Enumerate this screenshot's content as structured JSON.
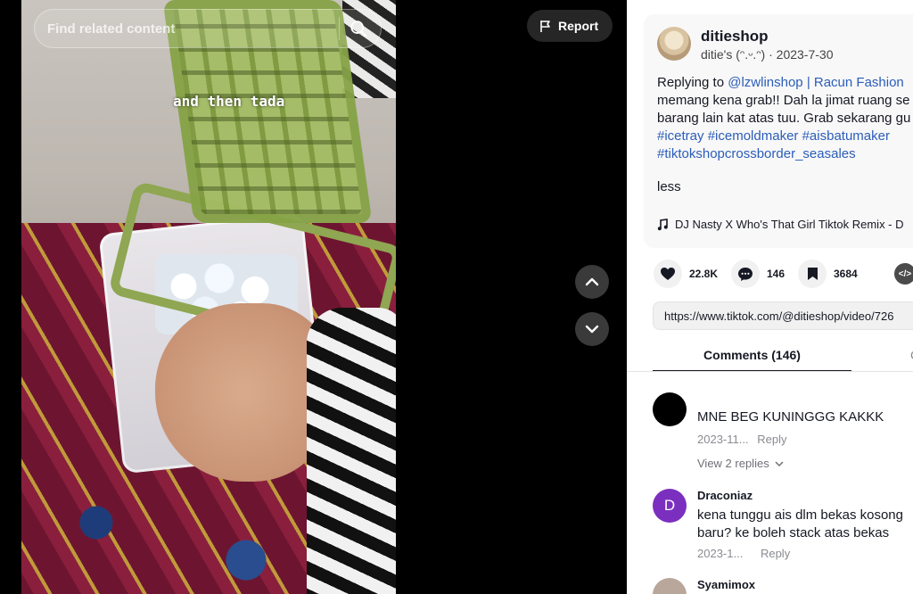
{
  "search": {
    "placeholder": "Find related content"
  },
  "video": {
    "caption": "and then tada"
  },
  "report": {
    "label": "Report"
  },
  "author": {
    "name": "ditieshop",
    "display_name": "ditie's (ᵔ.ᵕ.ᵔ)",
    "date": "2023-7-30"
  },
  "description": {
    "reply_prefix": "Replying to ",
    "mention": "@lzwlinshop | Racun Fashion",
    "line2": "memang kena grab!! Dah la jimat ruang se",
    "line3": "barang lain kat atas tuu. Grab sekarang gu",
    "tags_line1": [
      "#icetray",
      "#icemoldmaker",
      "#aisbatumaker"
    ],
    "tags_line2": "#tiktokshopcrossborder_seasales",
    "less_label": "less"
  },
  "music": {
    "title": "DJ Nasty X Who's That Girl Tiktok Remix - D"
  },
  "actions": {
    "likes": "22.8K",
    "comments": "146",
    "saves": "3684",
    "embed_label": "</>"
  },
  "link": {
    "url": "https://www.tiktok.com/@ditieshop/video/726"
  },
  "tabs": {
    "comments_label": "Comments (146)"
  },
  "comments": [
    {
      "name": "",
      "text": "MNE BEG KUNINGGG KAKKK",
      "date": "2023-11...",
      "reply_label": "Reply",
      "replies_label": "View 2 replies",
      "avatar_color": "#000000"
    },
    {
      "name": "Draconiaz",
      "avatar_letter": "D",
      "text_line1": "kena tunggu ais dlm bekas kosong",
      "text_line2": "baru? ke boleh stack atas bekas",
      "date": "2023-1...",
      "reply_label": "Reply",
      "avatar_color": "#7b2fbf"
    },
    {
      "name": "Syamimox",
      "avatar_color": "#b8a79a"
    }
  ],
  "colors": {
    "accent_link": "#2b5db9",
    "text_primary": "#161823"
  }
}
